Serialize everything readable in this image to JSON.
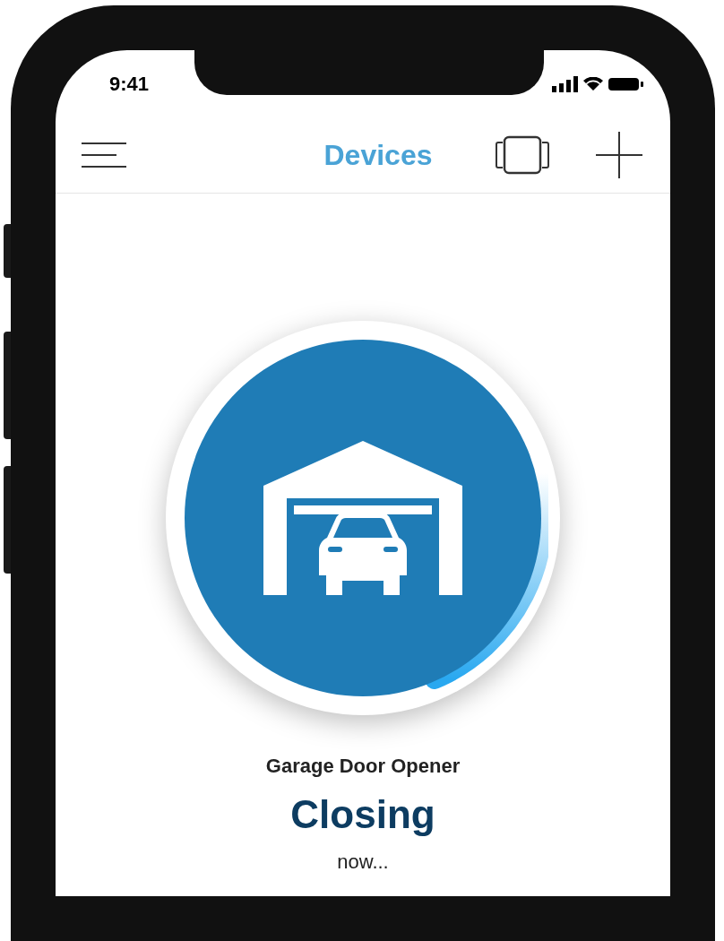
{
  "status_bar": {
    "time": "9:41"
  },
  "header": {
    "title": "Devices"
  },
  "device": {
    "name": "Garage Door Opener",
    "status": "Closing",
    "status_detail": "now..."
  }
}
